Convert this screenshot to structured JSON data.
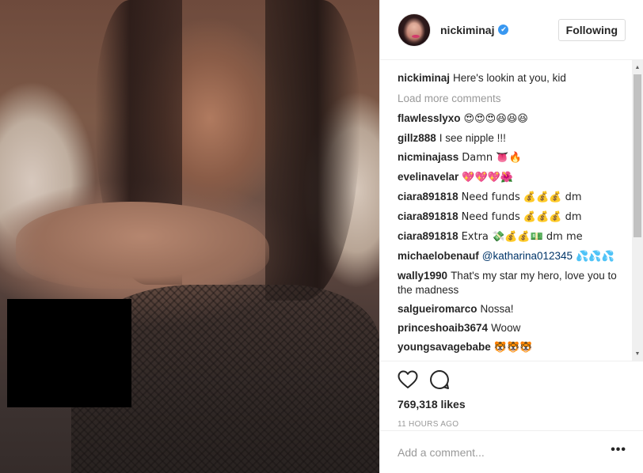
{
  "header": {
    "username": "nickiminaj",
    "verified_badge": "✔",
    "follow_label": "Following"
  },
  "caption": {
    "username": "nickiminaj",
    "text": "Here's lookin at you, kid"
  },
  "load_more": "Load more comments",
  "comments": [
    {
      "user": "flawlesslyxo",
      "text": "😍😍😍😆😆😆"
    },
    {
      "user": "gillz888",
      "text": "I see nipple !!!"
    },
    {
      "user": "nicminajass",
      "text": "Damn 👅🔥"
    },
    {
      "user": "evelinavelar",
      "text": "💖💖💖🌺"
    },
    {
      "user": "ciara891818",
      "text": "Need funds 💰💰💰 dm"
    },
    {
      "user": "ciara891818",
      "text": "Need funds 💰💰💰 dm"
    },
    {
      "user": "ciara891818",
      "text": "Extra 💸💰💰💵 dm me"
    },
    {
      "user": "michaelobenauf",
      "mention": "@katharina012345",
      "text": " 💦💦💦"
    },
    {
      "user": "wally1990",
      "text": "That's my star my hero, love you to the madness"
    },
    {
      "user": "salgueiromarco",
      "text": "Nossa!"
    },
    {
      "user": "princeshoaib3674",
      "text": "Woow"
    },
    {
      "user": "youngsavagebabe",
      "text": "🐯🐯🐯"
    }
  ],
  "actions": {
    "likes": "769,318 likes",
    "time": "11 HOURS AGO"
  },
  "add_comment": {
    "placeholder": "Add a comment...",
    "more_label": "•••"
  },
  "icons": [
    "heart-icon",
    "comment-icon",
    "more-options-icon"
  ],
  "colors": {
    "verified": "#3897f0",
    "muted": "#999999",
    "text": "#262626",
    "border": "#efefef"
  }
}
